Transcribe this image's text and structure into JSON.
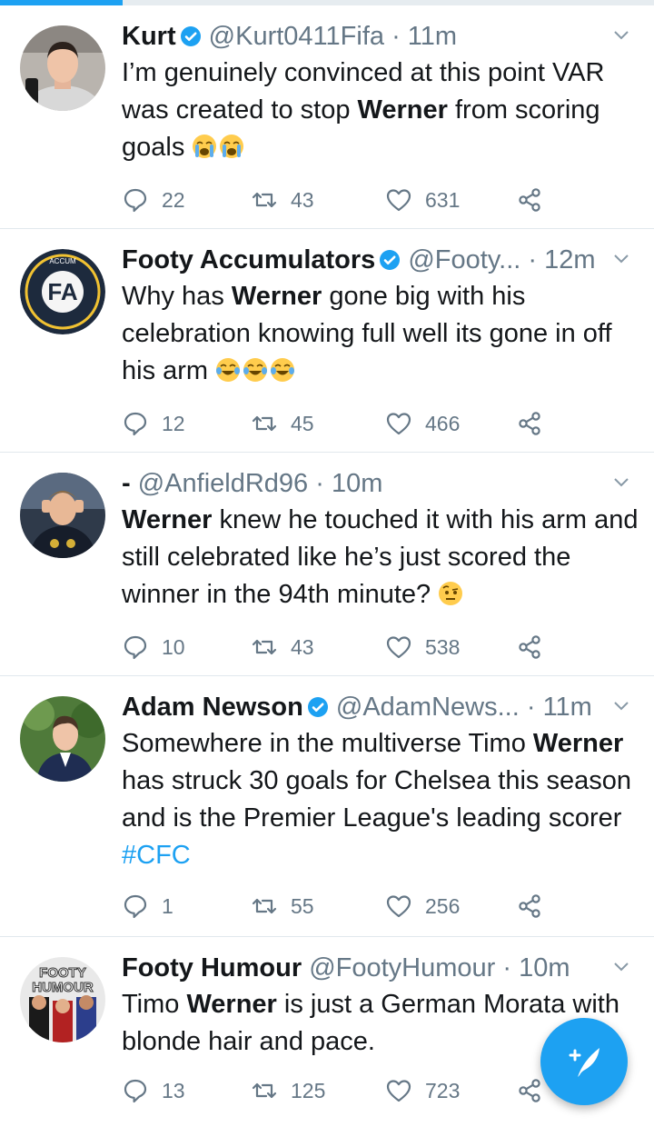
{
  "colors": {
    "accent": "#1da1f2",
    "text": "#14171a",
    "secondary": "#657786",
    "divider": "#e1e8ed"
  },
  "tweets": [
    {
      "name": "Kurt",
      "verified": true,
      "handle": "@Kurt0411Fifa",
      "time": "11m",
      "text": [
        {
          "t": "I’m genuinely convinced at this point VAR was created to stop "
        },
        {
          "t": "Werner",
          "b": true
        },
        {
          "t": " from scoring goals "
        }
      ],
      "emojis": [
        "loudly-crying-face",
        "loudly-crying-face"
      ],
      "replies": "22",
      "retweets": "43",
      "likes": "631"
    },
    {
      "name": "Footy Accumulators",
      "verified": true,
      "handle": "@Footy...",
      "time": "12m",
      "text": [
        {
          "t": "Why has "
        },
        {
          "t": "Werner",
          "b": true
        },
        {
          "t": " gone big with his celebration knowing full well its gone in off his arm "
        }
      ],
      "emojis": [
        "tears-of-joy-face",
        "tears-of-joy-face",
        "tears-of-joy-face"
      ],
      "replies": "12",
      "retweets": "45",
      "likes": "466"
    },
    {
      "name": "-",
      "verified": false,
      "handle": "@AnfieldRd96",
      "time": "10m",
      "text": [
        {
          "t": "Werner",
          "b": true
        },
        {
          "t": " knew he touched it with his arm and still celebrated like he’s just scored the winner in the 94th minute? "
        }
      ],
      "emojis": [
        "raised-eyebrow-face"
      ],
      "replies": "10",
      "retweets": "43",
      "likes": "538"
    },
    {
      "name": "Adam Newson",
      "verified": true,
      "handle": "@AdamNews...",
      "time": "11m",
      "text": [
        {
          "t": "Somewhere in the multiverse Timo "
        },
        {
          "t": "Werner",
          "b": true
        },
        {
          "t": " has struck 30 goals for Chelsea this season and is the Premier League's leading scorer "
        },
        {
          "t": "#CFC",
          "h": true
        }
      ],
      "emojis": [],
      "replies": "1",
      "retweets": "55",
      "likes": "256"
    },
    {
      "name": "Footy Humour",
      "verified": false,
      "handle": "@FootyHumour",
      "time": "10m",
      "avatar_text": [
        "FOOTY",
        "HUMOUR"
      ],
      "text": [
        {
          "t": "Timo "
        },
        {
          "t": "Werner",
          "b": true
        },
        {
          "t": " is just a German Morata with blonde hair and pace."
        }
      ],
      "emojis": [],
      "replies": "13",
      "retweets": "125",
      "likes": "723"
    }
  ],
  "fab": {
    "icon": "compose-tweet-icon"
  }
}
